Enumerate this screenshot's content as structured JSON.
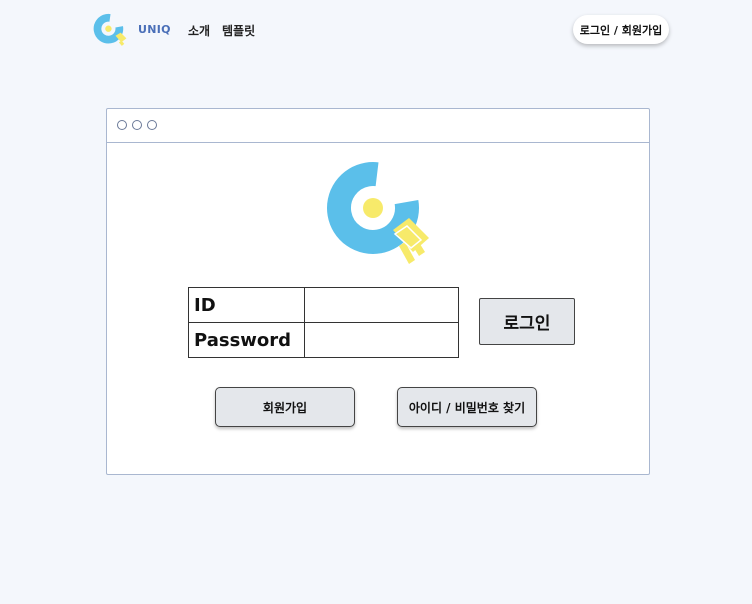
{
  "header": {
    "brand": "UNIQ",
    "nav": {
      "intro": "소개",
      "template": "템플릿"
    },
    "login_join_label": "로그인 / 회원가입"
  },
  "login": {
    "id_label": "ID",
    "password_label": "Password",
    "id_value": "",
    "password_value": "",
    "submit_label": "로그인",
    "signup_label": "회원가입",
    "find_label": "아이디 / 비밀번호 찾기"
  },
  "colors": {
    "logo_blue": "#5bbfea",
    "logo_yellow": "#f7ea6a",
    "brand_text": "#4a6fb8",
    "background": "#f4f7fc",
    "button_gray": "#e4e7eb"
  },
  "icons": {
    "logo": "uniq-key-logo",
    "window_controls": [
      "window-dot-icon",
      "window-dot-icon",
      "window-dot-icon"
    ]
  }
}
